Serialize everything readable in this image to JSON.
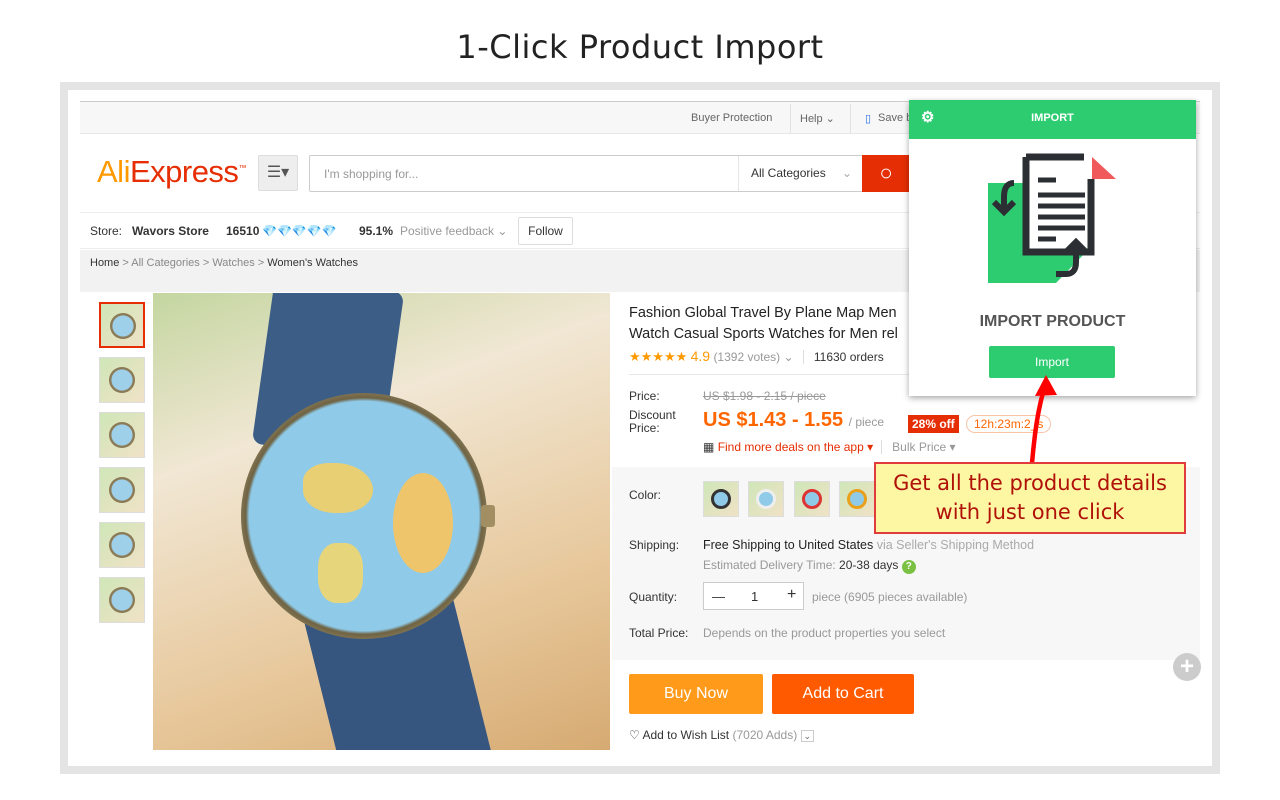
{
  "banner_title": "1-Click Product Import",
  "topbar": {
    "buyer_protection": "Buyer Protection",
    "help": "Help ⌄",
    "save": "Save b"
  },
  "header": {
    "logo": "AliExpress",
    "search_placeholder": "I'm shopping for...",
    "category": "All Categories"
  },
  "store": {
    "label": "Store:",
    "name": "Wavors Store",
    "score": "16510",
    "feedback_pct": "95.1%",
    "feedback_label": "Positive feedback ⌄",
    "follow": "Follow"
  },
  "breadcrumb": [
    "Home",
    "All Categories",
    "Watches",
    "Women's Watches"
  ],
  "product": {
    "title_line1": "Fashion Global Travel By Plane Map Men",
    "title_line2": "Watch Casual Sports Watches for Men rel",
    "rating": "4.9",
    "votes": "(1392 votes)",
    "orders": "11630 orders",
    "price_label": "Price:",
    "old_price": "US $1.98 - 2.15 / piece",
    "discount_label": "Discount Price:",
    "new_price": "US $1.43 - 1.55",
    "unit": "/ piece",
    "off": "28% off",
    "timer": "12h:23m:2_s",
    "deals": "Find more deals on the app ▾",
    "bulk": "Bulk Price ▾",
    "color_label": "Color:",
    "shipping_label": "Shipping:",
    "shipping": "Free Shipping to United States",
    "shipping_via": " via Seller's Shipping Method",
    "eta_label": "Estimated Delivery Time:",
    "eta": "20-38 days",
    "quantity_label": "Quantity:",
    "quantity": "1",
    "available": "piece (6905 pieces available)",
    "total_label": "Total Price:",
    "total": "Depends on the product properties you select",
    "buy_now": "Buy Now",
    "add_to_cart": "Add to Cart",
    "wishlist": "Add to Wish List",
    "wish_count": "(7020 Adds)"
  },
  "popup": {
    "header": "IMPORT",
    "heading": "IMPORT PRODUCT",
    "button": "Import",
    "accent": "#2ecc71"
  },
  "callout": {
    "line1": "Get all the product details",
    "line2": "with just one click"
  }
}
